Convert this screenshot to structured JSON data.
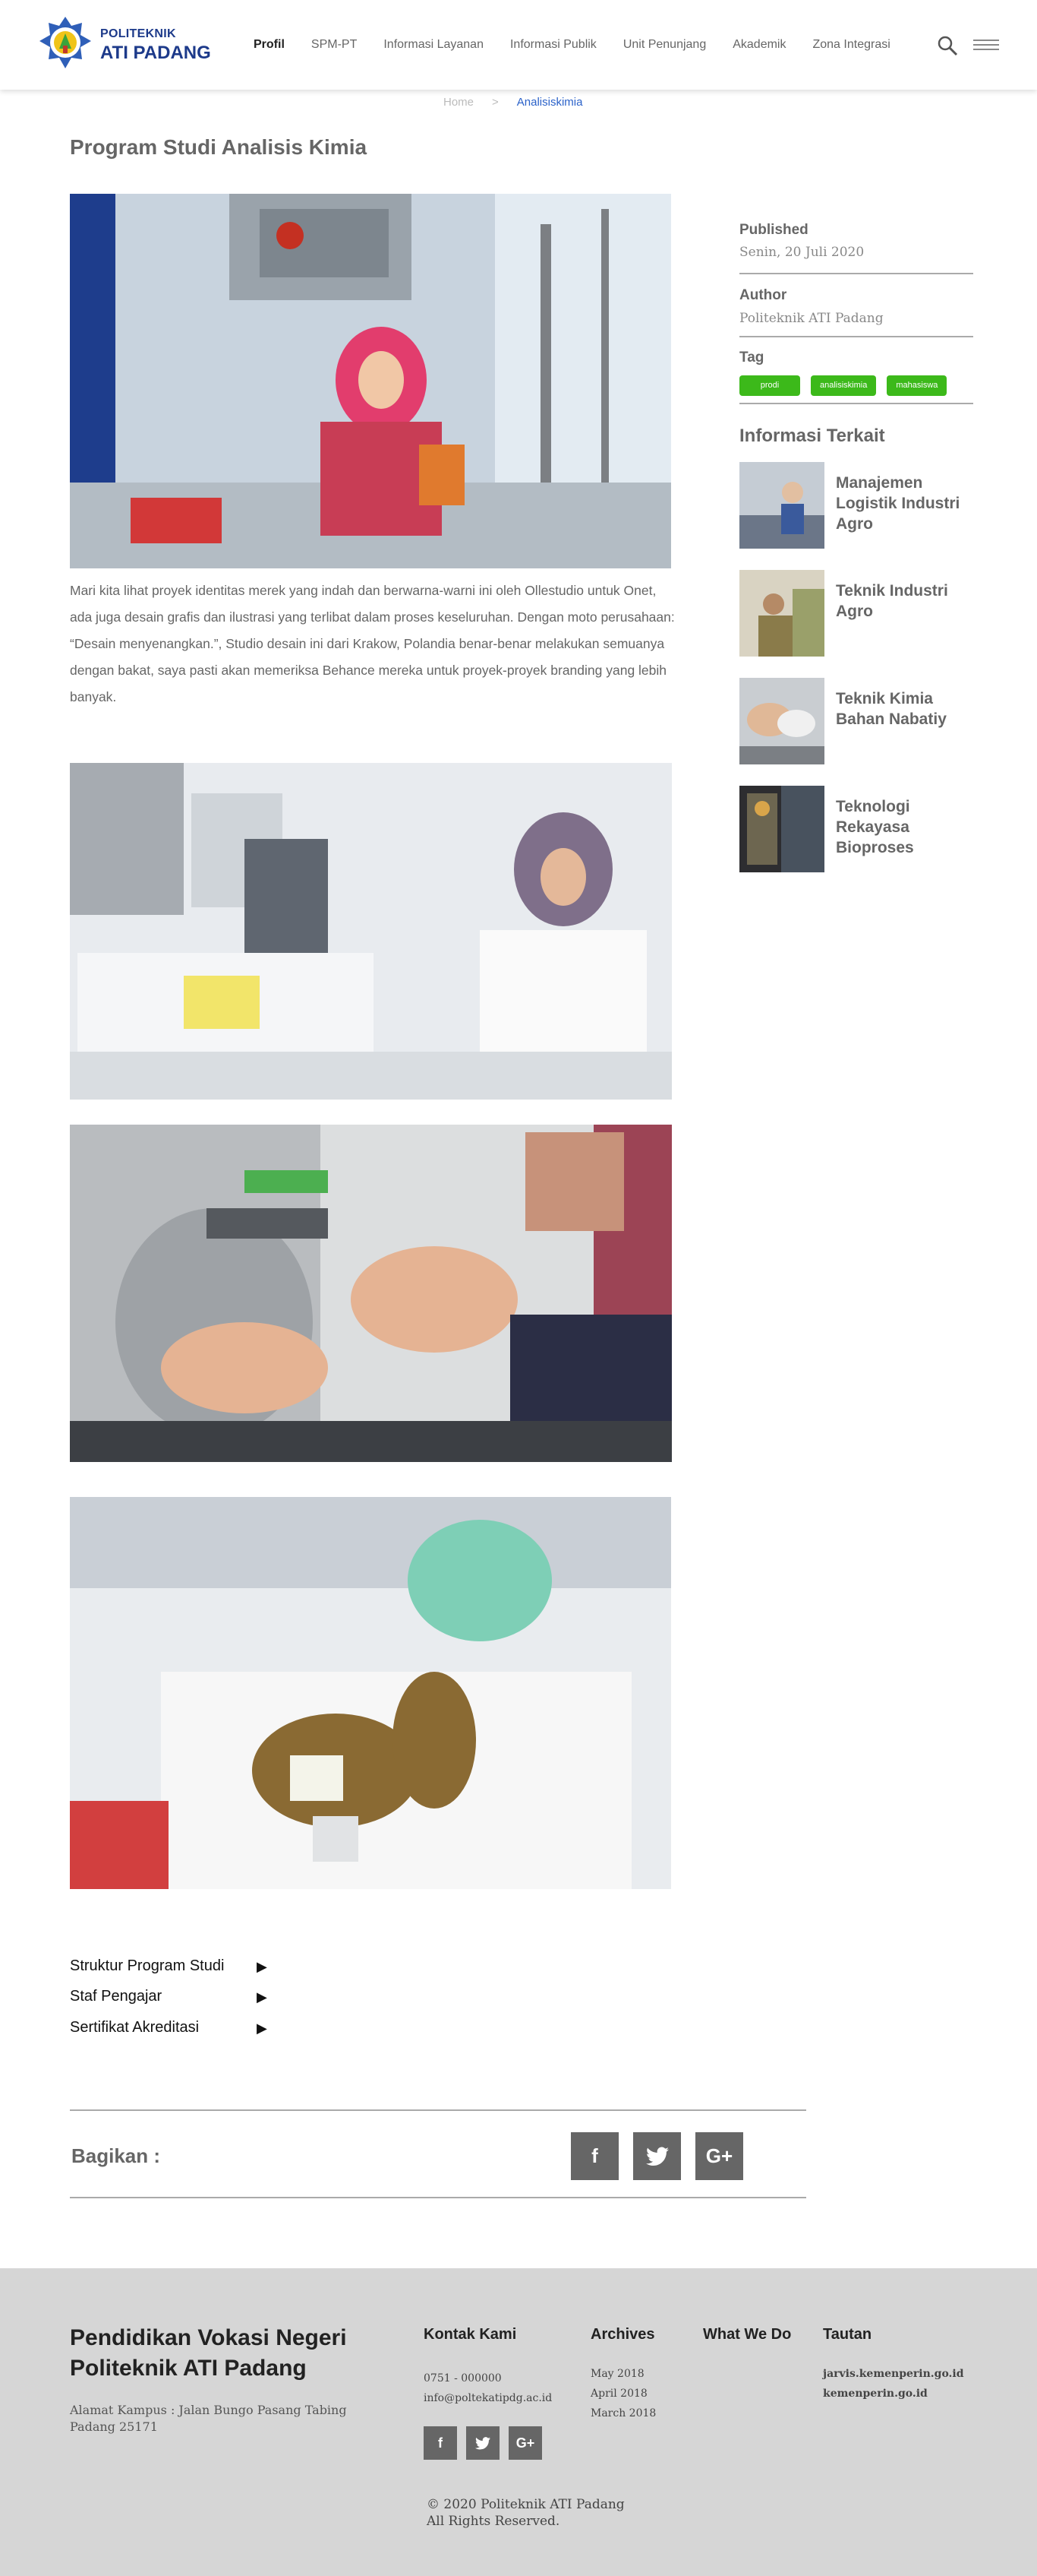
{
  "header": {
    "logo_line1": "POLITEKNIK",
    "logo_line2": "ATI PADANG",
    "nav": [
      "Profil",
      "SPM-PT",
      "Informasi Layanan",
      "Informasi Publik",
      "Unit Penunjang",
      "Akademik",
      "Zona Integrasi"
    ],
    "active_nav": "Profil"
  },
  "breadcrumb": {
    "home": "Home",
    "separator": ">",
    "current": "Analisiskimia"
  },
  "page_title": "Program Studi Analisis Kimia",
  "main_text": "Mari kita lihat proyek identitas merek yang indah dan berwarna-warni ini oleh Ollestudio untuk Onet, ada juga desain grafis dan ilustrasi yang terlibat dalam proses keseluruhan. Dengan moto perusahaan: “Desain menyenangkan.”, Studio desain ini dari Krakow, Polandia benar-benar melakukan semuanya dengan bakat, saya pasti akan memeriksa Behance mereka untuk proyek-proyek branding yang lebih banyak.",
  "sidebar": {
    "published_label": "Published",
    "published_value": "Senin, 20 Juli 2020",
    "author_label": "Author",
    "author_value": "Politeknik ATI Padang",
    "tag_label": "Tag",
    "tags": [
      "prodi",
      "analisiskimia",
      "mahasiswa"
    ],
    "related_title": "Informasi Terkait",
    "related": [
      "Manajemen Logistik Industri Agro",
      "Teknik Industri Agro",
      "Teknik Kimia Bahan Nabatiy",
      "Teknologi Rekayasa Bioproses"
    ]
  },
  "accordion": [
    "Struktur Program Studi",
    "Staf Pengajar",
    "Sertifikat Akreditasi"
  ],
  "share": {
    "label": "Bagikan :",
    "icons": [
      "f",
      "twitter",
      "G+"
    ]
  },
  "footer": {
    "title": "Pendidikan Vokasi Negeri Politeknik ATI Padang",
    "address": "Alamat Kampus : Jalan Bungo Pasang Tabing Padang 25171",
    "contact_head": "Kontak Kami",
    "phone": "0751 - 000000",
    "email": "info@poltekatipdg.ac.id",
    "archives_head": "Archives",
    "archives": [
      "May 2018",
      "April 2018",
      "March 2018"
    ],
    "whatwedo_head": "What We Do",
    "tautan_head": "Tautan",
    "links": [
      "jarvis.kemenperin.go.id",
      "kemenperin.go.id"
    ],
    "copyright1": "© 2020 Politeknik ATI Padang",
    "copyright2": "All Rights Reserved."
  },
  "colors": {
    "brand_blue": "#1d3a8a",
    "tag_green": "#3cb91a",
    "link_blue": "#2b62c9",
    "footer_bg": "#d6d6d6"
  }
}
